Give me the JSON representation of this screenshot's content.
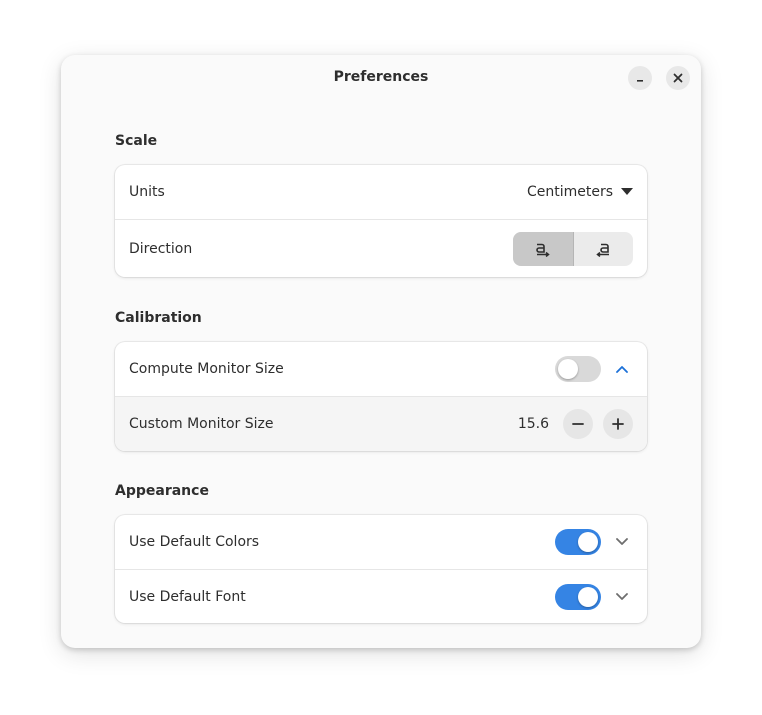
{
  "window": {
    "title": "Preferences"
  },
  "titlebar": {
    "minimize_icon": "minimize-icon",
    "close_icon": "close-icon"
  },
  "sections": {
    "scale": {
      "title": "Scale",
      "units": {
        "label": "Units",
        "value": "Centimeters",
        "icon": "pan-down-icon"
      },
      "direction": {
        "label": "Direction",
        "options": [
          {
            "icon": "ltr-direction-icon",
            "selected": true
          },
          {
            "icon": "rtl-direction-icon",
            "selected": false
          }
        ]
      }
    },
    "calibration": {
      "title": "Calibration",
      "compute": {
        "label": "Compute Monitor Size",
        "enabled": false,
        "expanded": true
      },
      "custom": {
        "label": "Custom Monitor Size",
        "value": "15.6"
      }
    },
    "appearance": {
      "title": "Appearance",
      "default_colors": {
        "label": "Use Default Colors",
        "enabled": true,
        "expanded": false
      },
      "default_font": {
        "label": "Use Default Font",
        "enabled": true,
        "expanded": false
      }
    }
  },
  "colors": {
    "accent": "#3584e4",
    "window_bg": "#fafafa",
    "card_bg": "#ffffff"
  }
}
